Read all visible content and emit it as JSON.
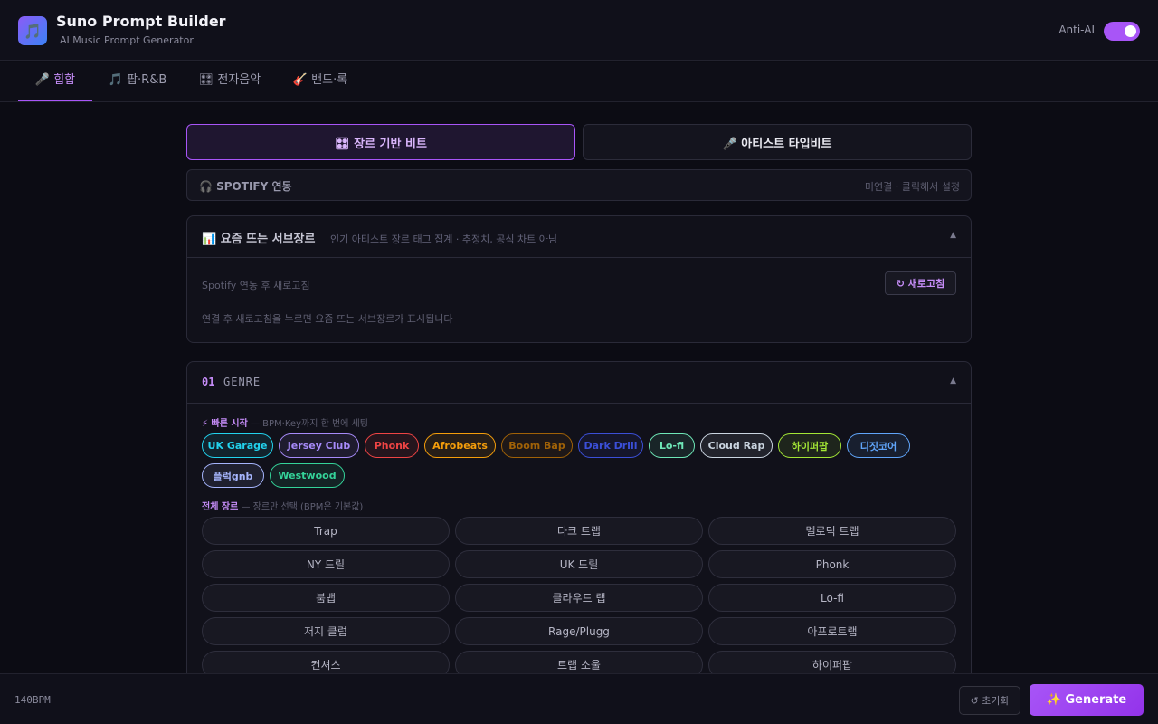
{
  "header": {
    "logo_icon": "🎵",
    "title": "Suno Prompt Builder",
    "subtitle": "AI Music Prompt Generator",
    "anti_ai_label": "Anti-AI",
    "anti_ai_enabled": true
  },
  "tabs": [
    {
      "label": "🎤 힙합",
      "active": true
    },
    {
      "label": "🎵 팝·R&B",
      "active": false
    },
    {
      "label": "🎛 전자음악",
      "active": false
    },
    {
      "label": "🎸 밴드·록",
      "active": false
    }
  ],
  "modes": {
    "genre_beat": "🎛 장르 기반 비트",
    "artist_beat": "🎤 아티스트 타입비트"
  },
  "spotify": {
    "label": "🎧 SPOTIFY 연동",
    "status": "미연결 · 클릭해서 설정"
  },
  "trending": {
    "title": "📊 요즘 뜨는 서브장르",
    "subtitle": "인기 아티스트 장르 태그 집계 · 추정치, 공식 차트 아님",
    "caret": "▲",
    "info": "Spotify 연동 후 새로고침",
    "refresh_label": "↻ 새로고침",
    "hint": "연결 후 새로고침을 누르면 요즘 뜨는 서브장르가 표시됩니다"
  },
  "genre": {
    "number": "01",
    "title": "GENRE",
    "caret": "▲",
    "quick_start_label": "⚡ 빠른 시작",
    "quick_start_desc": "— BPM·Key까지 한 번에 세팅",
    "quick_chips": [
      {
        "label": "UK Garage",
        "color": "#22d3ee"
      },
      {
        "label": "Jersey Club",
        "color": "#a78bfa"
      },
      {
        "label": "Phonk",
        "color": "#ef4444"
      },
      {
        "label": "Afrobeats",
        "color": "#f59e0b"
      },
      {
        "label": "Boom Bap",
        "color": "#a16207"
      },
      {
        "label": "Dark Drill",
        "color": "#3b4fd8"
      },
      {
        "label": "Lo-fi",
        "color": "#6ee7b7"
      },
      {
        "label": "Cloud Rap",
        "color": "#cbd5e1"
      },
      {
        "label": "하이퍼팝",
        "color": "#a3e635"
      },
      {
        "label": "디짓코어",
        "color": "#60a5fa"
      },
      {
        "label": "플럭gnb",
        "color": "#a5b4fc"
      },
      {
        "label": "Westwood",
        "color": "#34d399"
      }
    ],
    "all_label": "전체 장르",
    "all_desc": "— 장르만 선택 (BPM은 기본값)",
    "all_genres": [
      "Trap",
      "다크 트랩",
      "멜로딕 트랩",
      "NY 드릴",
      "UK 드릴",
      "Phonk",
      "붐뱁",
      "클라우드 랩",
      "Lo-fi",
      "저지 클럽",
      "Rage/Plugg",
      "아프로트랩",
      "컨셔스",
      "트랩 소울",
      "하이퍼팝"
    ]
  },
  "footer": {
    "bpm": "140BPM",
    "reset_label": "↺ 초기화",
    "generate_label": "✨ Generate"
  }
}
